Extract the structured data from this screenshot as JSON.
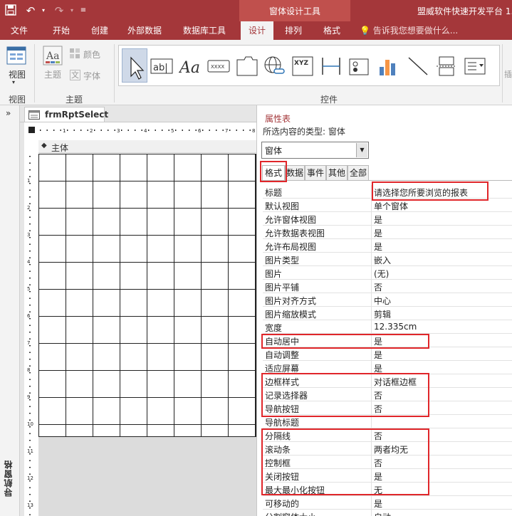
{
  "window": {
    "context_tab_title": "窗体设计工具",
    "app_title": "盟威软件快速开发平台 1."
  },
  "ribbon_tabs": [
    "文件",
    "开始",
    "创建",
    "外部数据",
    "数据库工具",
    "设计",
    "排列",
    "格式"
  ],
  "active_tab": "设计",
  "tell_me": "告诉我您想要做什么...",
  "ribbon": {
    "view_label": "视图",
    "theme_label": "主题",
    "colors_label": "颜色",
    "fonts_label": "字体",
    "group_view": "视图",
    "group_theme": "主题",
    "group_controls": "控件",
    "abl_text": "ab|",
    "aa_text": "Aa",
    "xxxx_text": "XXXX",
    "xyz_text": "XYZ"
  },
  "nav_pane": {
    "collapse": "»",
    "label": "导航窗格"
  },
  "document": {
    "tab_label": "frmRptSelect",
    "section_label": "主体"
  },
  "property_sheet": {
    "title": "属性表",
    "selection_type": "所选内容的类型: 窗体",
    "combo_value": "窗体",
    "tabs": [
      "格式",
      "数据",
      "事件",
      "其他",
      "全部"
    ],
    "active_tab": "格式",
    "rows": [
      {
        "name": "标题",
        "value": "请选择您所要浏览的报表"
      },
      {
        "name": "默认视图",
        "value": "单个窗体"
      },
      {
        "name": "允许窗体视图",
        "value": "是"
      },
      {
        "name": "允许数据表视图",
        "value": "是"
      },
      {
        "name": "允许布局视图",
        "value": "是"
      },
      {
        "name": "图片类型",
        "value": "嵌入"
      },
      {
        "name": "图片",
        "value": "(无)"
      },
      {
        "name": "图片平铺",
        "value": "否"
      },
      {
        "name": "图片对齐方式",
        "value": "中心"
      },
      {
        "name": "图片缩放模式",
        "value": "剪辑"
      },
      {
        "name": "宽度",
        "value": "12.335cm"
      },
      {
        "name": "自动居中",
        "value": "是"
      },
      {
        "name": "自动调整",
        "value": "是"
      },
      {
        "name": "适应屏幕",
        "value": "是"
      },
      {
        "name": "边框样式",
        "value": "对话框边框"
      },
      {
        "name": "记录选择器",
        "value": "否"
      },
      {
        "name": "导航按钮",
        "value": "否"
      },
      {
        "name": "导航标题",
        "value": ""
      },
      {
        "name": "分隔线",
        "value": "否"
      },
      {
        "name": "滚动条",
        "value": "两者均无"
      },
      {
        "name": "控制框",
        "value": "否"
      },
      {
        "name": "关闭按钮",
        "value": "是"
      },
      {
        "name": "最大最小化按钮",
        "value": "无"
      },
      {
        "name": "可移动的",
        "value": "是"
      },
      {
        "name": "分割窗体大小",
        "value": "自动"
      }
    ]
  },
  "colors": {
    "accent": "#a4373a",
    "highlight": "#e0262a"
  }
}
